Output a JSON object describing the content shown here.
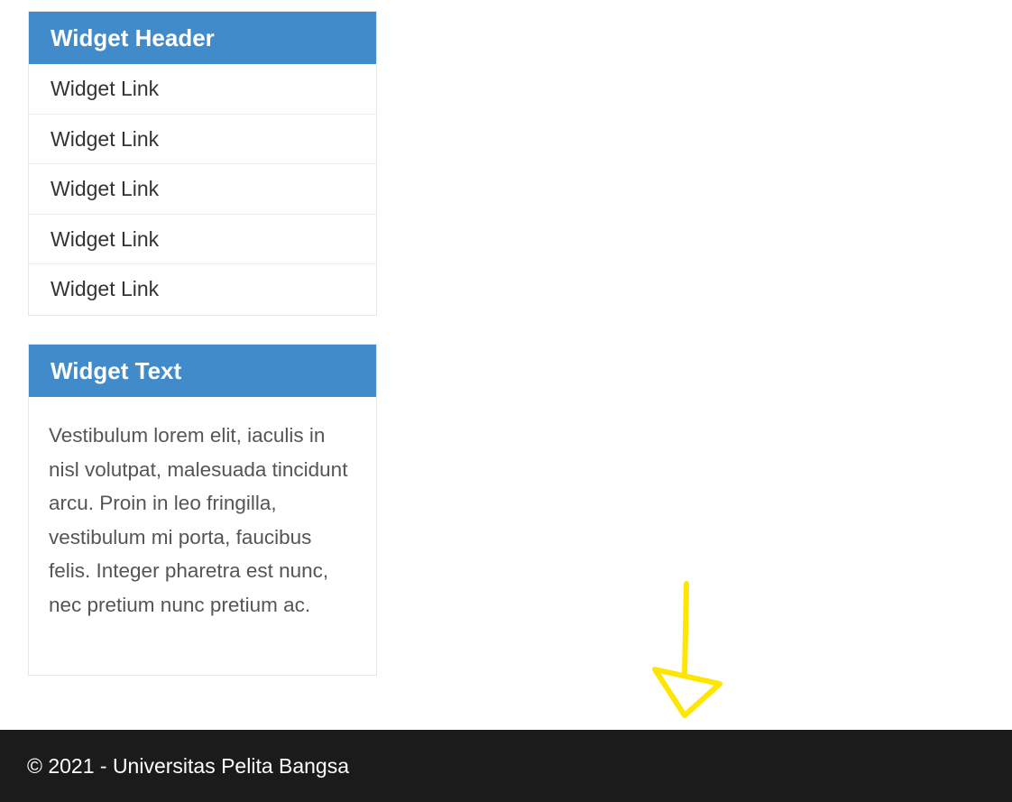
{
  "sidebar": {
    "links_widget": {
      "header": "Widget Header",
      "links": [
        "Widget Link",
        "Widget Link",
        "Widget Link",
        "Widget Link",
        "Widget Link"
      ]
    },
    "text_widget": {
      "header": "Widget Text",
      "body": "Vestibulum lorem elit, iaculis in nisl volutpat, malesuada tincidunt arcu. Proin in leo fringilla, vestibulum mi porta, faucibus felis. Integer pharetra est nunc, nec pretium nunc pretium ac."
    }
  },
  "footer": {
    "copyright": "© 2021 - Universitas Pelita Bangsa"
  },
  "colors": {
    "widget_header_bg": "#428bca",
    "footer_bg": "#1b1b1b",
    "annotation_arrow": "#ffe600"
  },
  "annotation": {
    "icon": "down-arrow-icon"
  }
}
